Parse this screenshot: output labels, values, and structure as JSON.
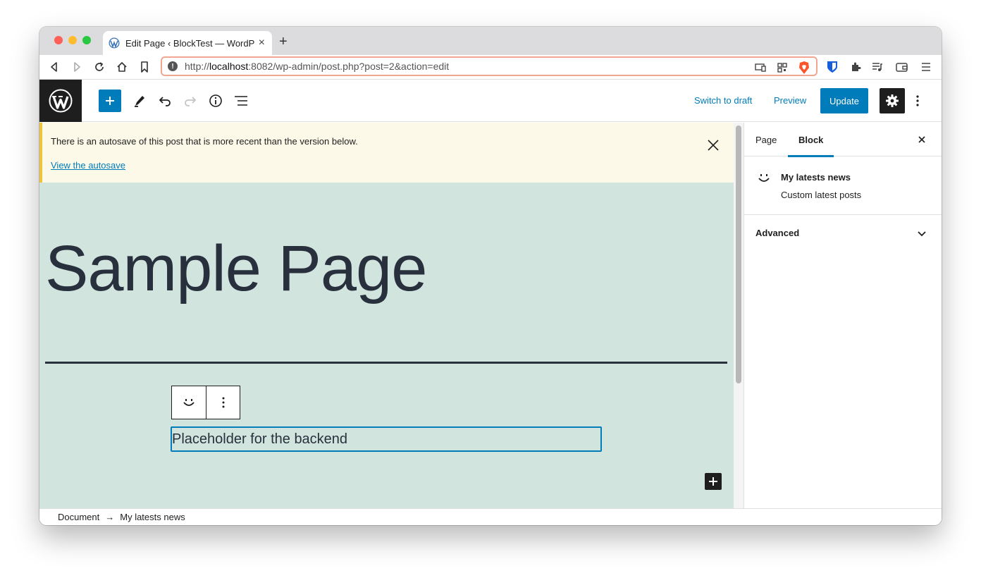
{
  "browser": {
    "tab_title": "Edit Page ‹ BlockTest — WordPress",
    "tab_close": "×",
    "new_tab": "+",
    "url_prefix": "http://",
    "url_host": "localhost",
    "url_rest": ":8082/wp-admin/post.php?post=2&action=edit"
  },
  "header": {
    "switch_to_draft": "Switch to draft",
    "preview": "Preview",
    "update": "Update"
  },
  "notice": {
    "text": "There is an autosave of this post that is more recent than the version below.",
    "link": "View the autosave"
  },
  "canvas": {
    "page_title": "Sample Page",
    "block_placeholder": "Placeholder for the backend"
  },
  "sidebar": {
    "tabs": [
      {
        "label": "Page"
      },
      {
        "label": "Block",
        "active": true
      }
    ],
    "block_card": {
      "title": "My latests news",
      "description": "Custom latest posts"
    },
    "panels": [
      {
        "title": "Advanced"
      }
    ]
  },
  "breadcrumb": {
    "items": [
      "Document",
      "My latests news"
    ],
    "separator": "→"
  },
  "colors": {
    "accent": "#007cba",
    "canvas_bg": "#d1e4dd",
    "notice_bg": "#fcf9e8",
    "dark": "#1e1e1e"
  }
}
